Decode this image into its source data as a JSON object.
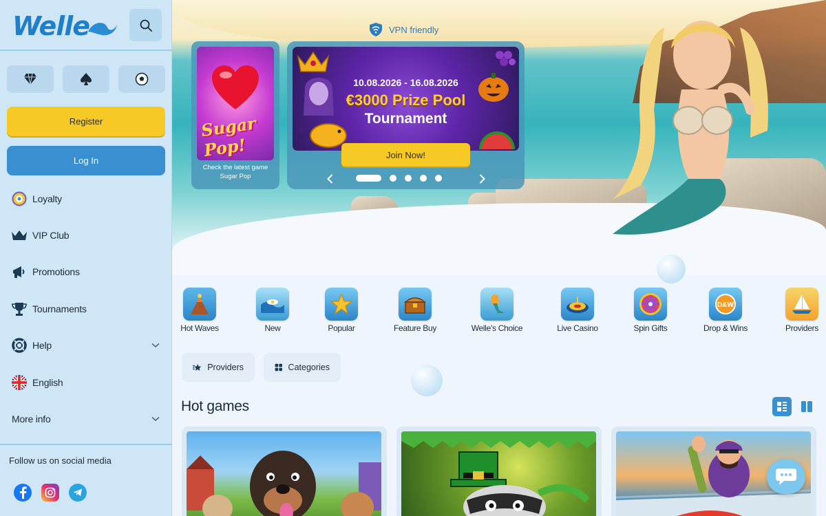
{
  "brand": {
    "logo_text": "Welle",
    "accent": "#1f7fc8",
    "yellow": "#f7c925",
    "blue": "#3a8fd0"
  },
  "sidebar": {
    "search_icon": "search-icon",
    "categories": [
      {
        "icon": "diamond-icon"
      },
      {
        "icon": "spade-icon"
      },
      {
        "icon": "soccer-ball-icon"
      }
    ],
    "register_label": "Register",
    "login_label": "Log In",
    "nav": [
      {
        "label": "Loyalty",
        "icon": "loyalty-badge-icon"
      },
      {
        "label": "VIP Club",
        "icon": "crown-icon"
      },
      {
        "label": "Promotions",
        "icon": "megaphone-icon"
      },
      {
        "label": "Tournaments",
        "icon": "trophy-icon"
      },
      {
        "label": "Help",
        "icon": "lifebuoy-icon",
        "expandable": true
      },
      {
        "label": "English",
        "icon": "uk-flag-icon"
      },
      {
        "label": "More info",
        "expandable": true
      }
    ],
    "follow_label": "Follow us on social media",
    "social": [
      "facebook-icon",
      "instagram-icon",
      "telegram-icon"
    ]
  },
  "hero": {
    "vpn_label": "VPN friendly",
    "promo": {
      "image_text": "Sugar Pop!",
      "caption_line1": "Check the latest game",
      "caption_line2": "Sugar Pop"
    },
    "tournament": {
      "dates": "10.08.2026 - 16.08.2026",
      "prize": "€3000 Prize Pool",
      "title": "Tournament",
      "cta": "Join Now!",
      "slide_count": 5,
      "active_slide": 1
    }
  },
  "categories": [
    {
      "label": "Hot Waves",
      "icon": "volcano-icon"
    },
    {
      "label": "New",
      "icon": "wave-icon"
    },
    {
      "label": "Popular",
      "icon": "star-icon"
    },
    {
      "label": "Feature Buy",
      "icon": "treasure-chest-icon"
    },
    {
      "label": "Welle's Choice",
      "icon": "mermaid-icon"
    },
    {
      "label": "Live Casino",
      "icon": "roulette-icon"
    },
    {
      "label": "Spin Gifts",
      "icon": "prize-wheel-icon"
    },
    {
      "label": "Drop & Wins",
      "icon": "dw-badge-icon"
    },
    {
      "label": "Providers",
      "icon": "sailboat-icon"
    }
  ],
  "filters": {
    "providers_label": "Providers",
    "categories_label": "Categories"
  },
  "hot_games": {
    "title": "Hot games",
    "view_modes": [
      "list-view-icon",
      "grid-view-icon"
    ],
    "games": [
      {
        "name": "dog-game-thumbnail"
      },
      {
        "name": "leprechaun-raccoon-game-thumbnail"
      },
      {
        "name": "fisherman-game-thumbnail"
      }
    ]
  },
  "chat": {
    "icon": "chat-bubble-icon"
  }
}
